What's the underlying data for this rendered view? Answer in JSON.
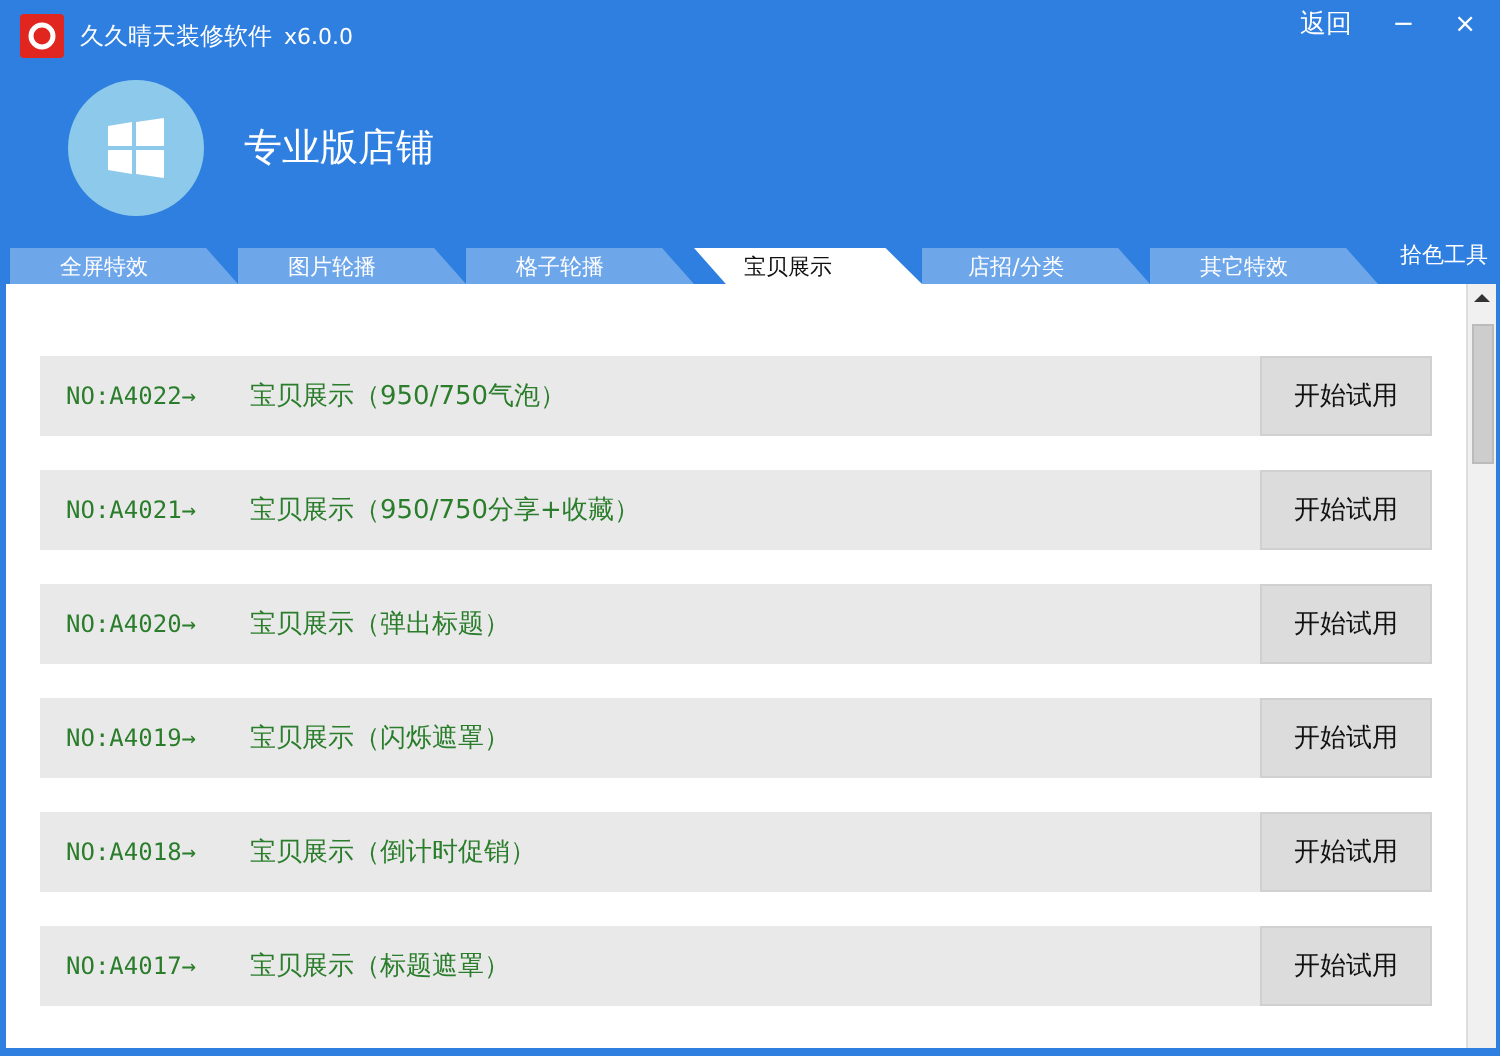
{
  "window": {
    "title": "久久晴天装修软件",
    "version": "x6.0.0",
    "controls": [
      "返回",
      "−",
      "×"
    ]
  },
  "banner": {
    "title": "专业版店铺"
  },
  "tabs": [
    {
      "label": "全屏特效",
      "selected": false
    },
    {
      "label": "图片轮播",
      "selected": false
    },
    {
      "label": "格子轮播",
      "selected": false
    },
    {
      "label": "宝贝展示",
      "selected": true
    },
    {
      "label": "店招/分类",
      "selected": false
    },
    {
      "label": "其它特效",
      "selected": false
    }
  ],
  "tool_link": "拾色工具",
  "items": [
    {
      "code": "NO:A4022→",
      "title": "宝贝展示（950/750气泡）",
      "button": "开始试用"
    },
    {
      "code": "NO:A4021→",
      "title": "宝贝展示（950/750分享+收藏）",
      "button": "开始试用"
    },
    {
      "code": "NO:A4020→",
      "title": "宝贝展示（弹出标题）",
      "button": "开始试用"
    },
    {
      "code": "NO:A4019→",
      "title": "宝贝展示（闪烁遮罩）",
      "button": "开始试用"
    },
    {
      "code": "NO:A4018→",
      "title": "宝贝展示（倒计时促销）",
      "button": "开始试用"
    },
    {
      "code": "NO:A4017→",
      "title": "宝贝展示（标题遮罩）",
      "button": "开始试用"
    }
  ]
}
